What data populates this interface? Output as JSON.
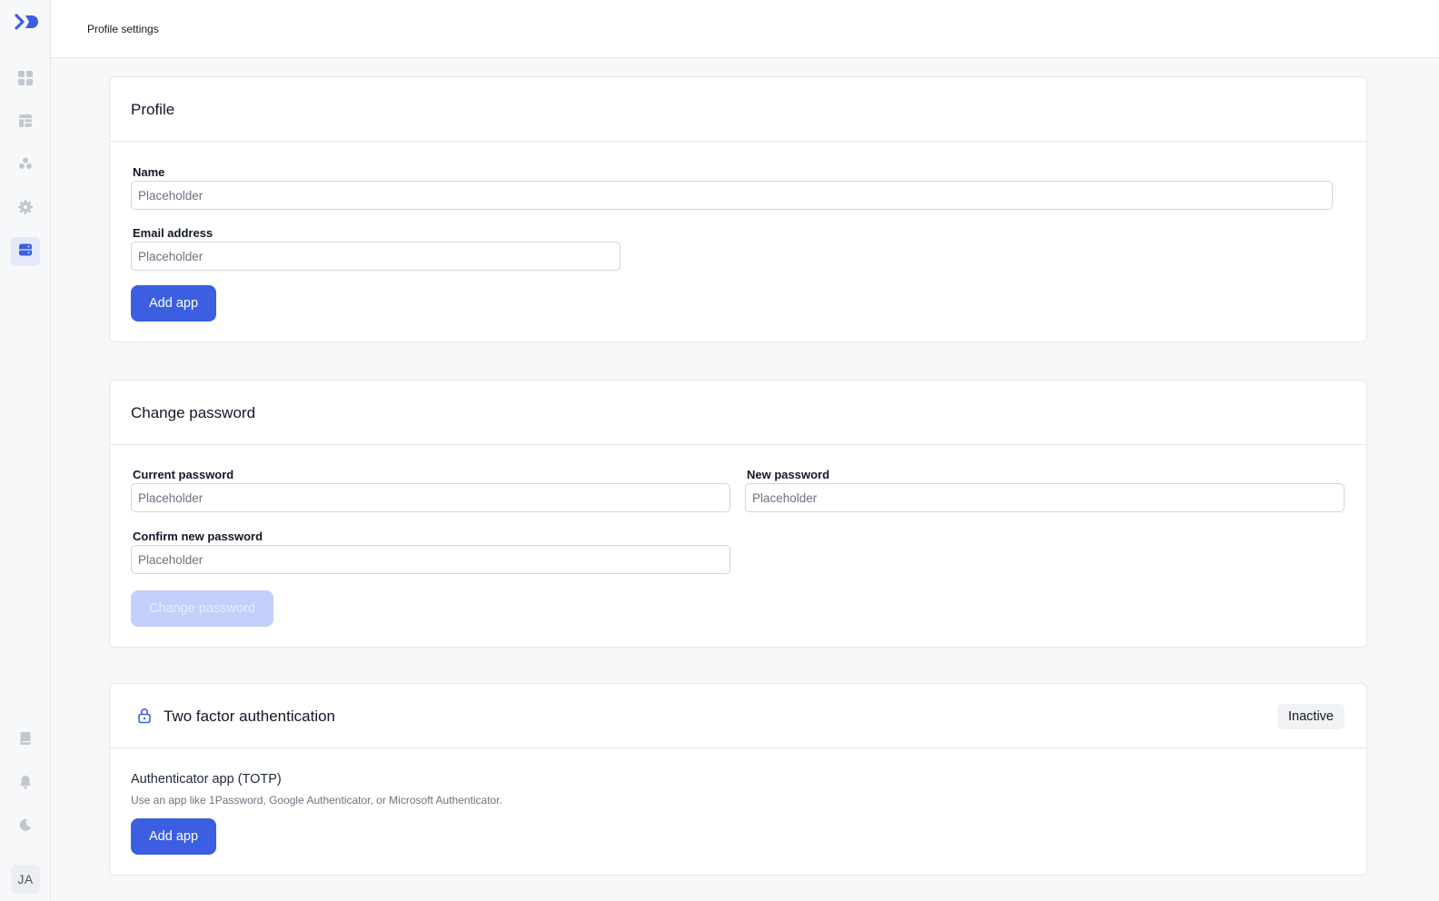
{
  "header": {
    "title": "Profile settings"
  },
  "user": {
    "initials": "JA"
  },
  "colors": {
    "accent": "#3b5fe0",
    "accent_disabled": "#c3cffa",
    "active_nav_bg": "#e3e8fb"
  },
  "sidebar": {
    "items": [
      {
        "icon": "dashboard-grid-icon"
      },
      {
        "icon": "table-icon"
      },
      {
        "icon": "users-icon"
      },
      {
        "icon": "gear-icon"
      },
      {
        "icon": "server-icon",
        "active": true
      }
    ],
    "bottom": [
      {
        "icon": "book-icon"
      },
      {
        "icon": "bell-icon"
      },
      {
        "icon": "moon-icon"
      }
    ]
  },
  "profile": {
    "title": "Profile",
    "name_label": "Name",
    "name_placeholder": "Placeholder",
    "email_label": "Email address",
    "email_placeholder": "Placeholder",
    "button_label": "Add app"
  },
  "password": {
    "title": "Change password",
    "current_label": "Current password",
    "current_placeholder": "Placeholder",
    "new_label": "New password",
    "new_placeholder": "Placeholder",
    "confirm_label": "Confirm new password",
    "confirm_placeholder": "Placeholder",
    "button_label": "Change password"
  },
  "two_factor": {
    "title": "Two factor authentication",
    "status": "Inactive",
    "method_title": "Authenticator app (TOTP)",
    "method_description": "Use an app like 1Password, Google Authenticator, or Microsoft Authenticator.",
    "button_label": "Add app"
  }
}
